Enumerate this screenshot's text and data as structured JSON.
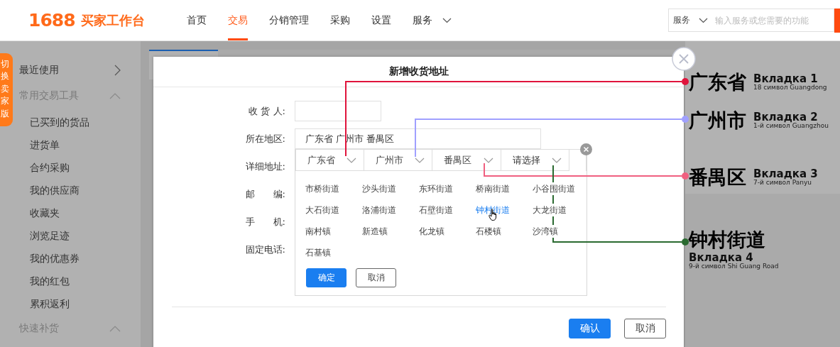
{
  "header": {
    "logo_number": "1688",
    "logo_text": "买家工作台"
  },
  "nav": [
    {
      "label": "首页",
      "selected": false,
      "dropdown": false
    },
    {
      "label": "交易",
      "selected": true,
      "dropdown": false
    },
    {
      "label": "分销管理",
      "selected": false,
      "dropdown": false
    },
    {
      "label": "采购",
      "selected": false,
      "dropdown": false
    },
    {
      "label": "设置",
      "selected": false,
      "dropdown": false
    },
    {
      "label": "服务",
      "selected": false,
      "dropdown": true
    }
  ],
  "search": {
    "scope": "服务",
    "placeholder": "输入服务或您需要的功能"
  },
  "sidebar": {
    "switch_tab": "切换卖家版",
    "sections": [
      {
        "title": "最近使用",
        "expanded": false
      },
      {
        "title": "常用交易工具",
        "expanded": true,
        "items": [
          "已买到的货品",
          "进货单",
          "合约采购",
          "我的供应商",
          "收藏夹",
          "浏览足迹",
          "我的优惠券",
          "我的红包",
          "累积返利"
        ]
      },
      {
        "title": "快速补货",
        "expanded": true
      }
    ]
  },
  "modal": {
    "title": "新增收货地址",
    "fields": [
      {
        "label": "收 货 人:",
        "kind": "input"
      },
      {
        "label": "所在地区:",
        "kind": "region",
        "value": "广东省 广州市 番禺区"
      },
      {
        "label": "详细地址:",
        "kind": "hidden"
      },
      {
        "label": "邮　　编:",
        "kind": "hidden"
      },
      {
        "label": "手　　机:",
        "kind": "hidden"
      },
      {
        "label": "固定电话:",
        "kind": "hidden"
      }
    ],
    "picker": {
      "tabs": [
        {
          "label": "广东省",
          "selected": false
        },
        {
          "label": "广州市",
          "selected": false
        },
        {
          "label": "番禺区",
          "selected": false
        },
        {
          "label": "请选择",
          "selected": true
        }
      ],
      "options": [
        {
          "label": "市桥街道",
          "selected": false
        },
        {
          "label": "沙头街道",
          "selected": false
        },
        {
          "label": "东环街道",
          "selected": false
        },
        {
          "label": "桥南街道",
          "selected": false
        },
        {
          "label": "小谷围街道",
          "selected": false
        },
        {
          "label": "大石街道",
          "selected": false
        },
        {
          "label": "洛浦街道",
          "selected": false
        },
        {
          "label": "石壁街道",
          "selected": false
        },
        {
          "label": "钟村街道",
          "selected": true
        },
        {
          "label": "大龙街道",
          "selected": false
        },
        {
          "label": "南村镇",
          "selected": false
        },
        {
          "label": "新造镇",
          "selected": false
        },
        {
          "label": "化龙镇",
          "selected": false
        },
        {
          "label": "石楼镇",
          "selected": false
        },
        {
          "label": "沙湾镇",
          "selected": false
        },
        {
          "label": "石基镇",
          "selected": false
        }
      ],
      "confirm": "确定",
      "cancel": "取消"
    },
    "confirm": "确认",
    "cancel": "取消"
  },
  "annotations": [
    {
      "title": "广东省",
      "tab": "Вкладка 1",
      "note": "18 символ Guangdong",
      "color": "#e0143c",
      "kind": "inline"
    },
    {
      "title": "广州市",
      "tab": "Вкладка 2",
      "note": "1-й символ Guangzhou",
      "color": "#a0a0ff",
      "kind": "inline"
    },
    {
      "title": "番禺区",
      "tab": "Вкладка 3",
      "note": "7-й символ Panyu",
      "color": "#f06080",
      "kind": "inline"
    },
    {
      "title": "钟村街道",
      "tab": "Вкладка 4",
      "note": "9-й символ Shi Guang Road",
      "color": "#2a6a30",
      "kind": "stacked"
    }
  ]
}
